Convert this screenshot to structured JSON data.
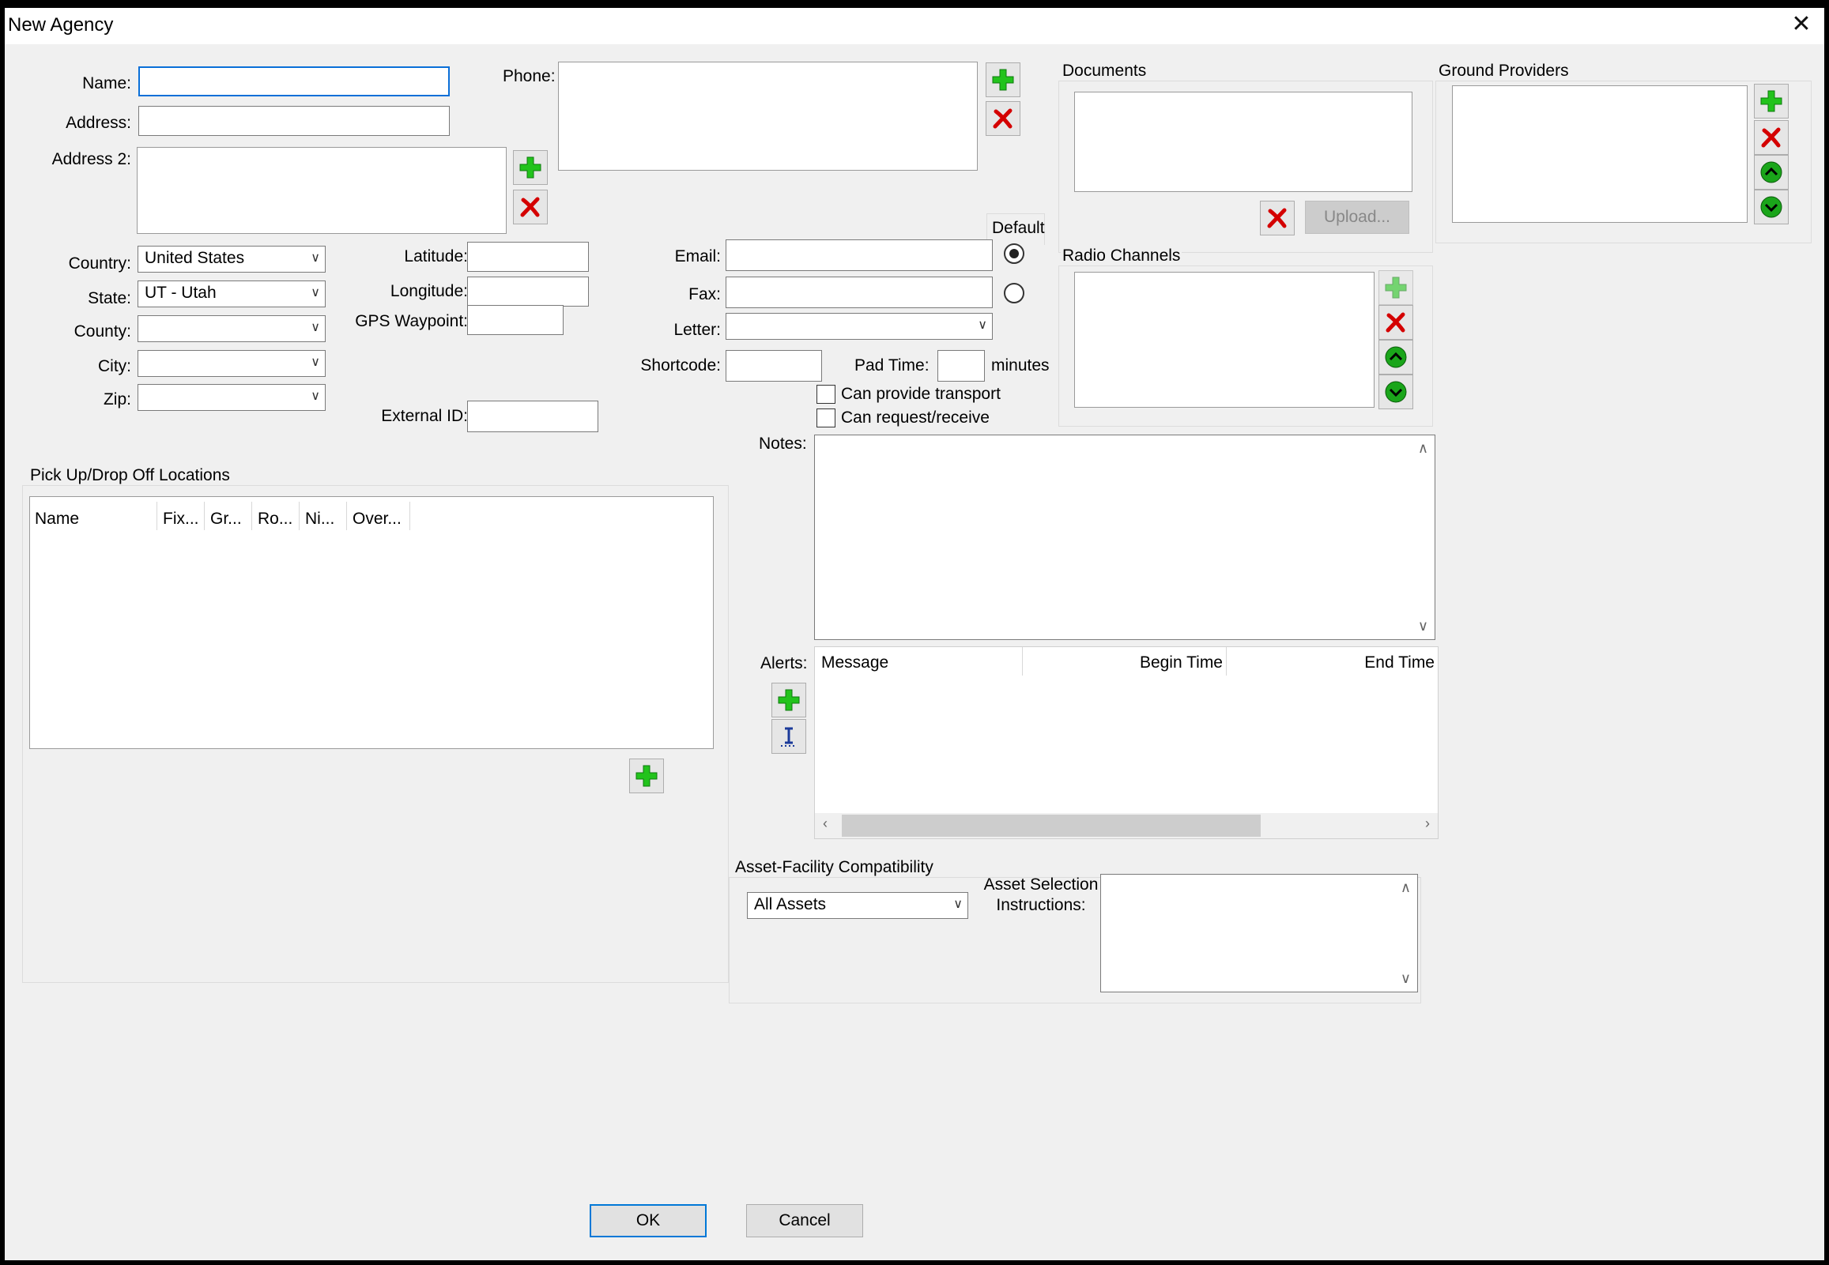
{
  "window": {
    "title": "New Agency",
    "close_glyph": "✕"
  },
  "form": {
    "name_label": "Name:",
    "address_label": "Address:",
    "address2_label": "Address 2:",
    "phone_label": "Phone:",
    "country_label": "Country:",
    "country_value": "United States",
    "state_label": "State:",
    "state_value": "UT - Utah",
    "county_label": "County:",
    "county_value": "",
    "city_label": "City:",
    "city_value": "",
    "zip_label": "Zip:",
    "zip_value": "",
    "latitude_label": "Latitude:",
    "longitude_label": "Longitude:",
    "gps_label": "GPS Waypoint:",
    "external_id_label": "External ID:",
    "default_label": "Default",
    "email_label": "Email:",
    "fax_label": "Fax:",
    "letter_label": "Letter:",
    "letter_value": "",
    "shortcode_label": "Shortcode:",
    "pad_time_label": "Pad Time:",
    "minutes_label": "minutes",
    "can_provide_transport": "Can provide transport",
    "can_request_receive": "Can request/receive",
    "notes_label": "Notes:",
    "alerts_label": "Alerts:"
  },
  "documents": {
    "title": "Documents",
    "upload_label": "Upload..."
  },
  "ground_providers": {
    "title": "Ground Providers"
  },
  "radio_channels": {
    "title": "Radio Channels"
  },
  "pickup": {
    "title": "Pick Up/Drop Off Locations",
    "columns": [
      "Name",
      "Fix...",
      "Gr...",
      "Ro...",
      "Ni...",
      "Over..."
    ]
  },
  "alerts": {
    "columns": [
      "Message",
      "Begin Time",
      "End Time"
    ]
  },
  "asset": {
    "title": "Asset-Facility Compatibility",
    "select_value": "All Assets",
    "instructions_label_1": "Asset Selection",
    "instructions_label_2": "Instructions:"
  },
  "footer": {
    "ok_label": "OK",
    "cancel_label": "Cancel"
  },
  "colors": {
    "add_green": "#22c31c",
    "remove_red": "#d40000",
    "arrow_green": "#1aa51a",
    "focus_blue": "#0a6fd8"
  },
  "icons": {
    "add": "plus-icon",
    "remove": "remove-x-icon",
    "up": "arrow-up-circle-icon",
    "down": "arrow-down-circle-icon",
    "edit": "text-cursor-icon"
  }
}
